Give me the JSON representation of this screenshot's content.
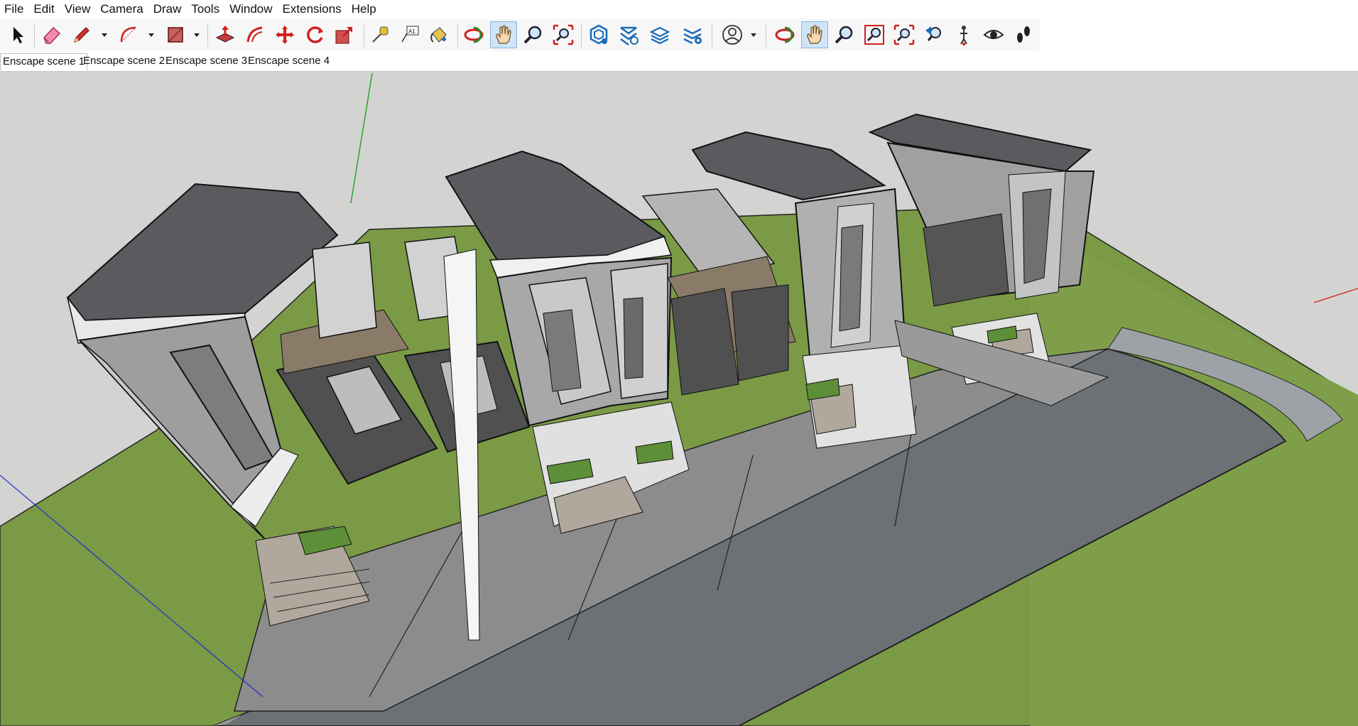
{
  "menu": [
    "File",
    "Edit",
    "View",
    "Camera",
    "Draw",
    "Tools",
    "Window",
    "Extensions",
    "Help"
  ],
  "toolbar": {
    "tools": [
      {
        "name": "select-icon"
      },
      {
        "name": "eraser-icon"
      },
      {
        "name": "pencil-line-icon"
      },
      {
        "name": "arc-icon"
      },
      {
        "name": "rectangle-icon"
      },
      {
        "name": "push-pull-icon"
      },
      {
        "name": "offset-icon"
      },
      {
        "name": "move-icon"
      },
      {
        "name": "rotate-icon"
      },
      {
        "name": "scale-icon"
      },
      {
        "name": "tape-measure-icon"
      },
      {
        "name": "text-label-icon"
      },
      {
        "name": "paint-bucket-icon"
      },
      {
        "name": "orbit-icon"
      },
      {
        "name": "pan-icon",
        "active": true
      },
      {
        "name": "zoom-icon"
      },
      {
        "name": "zoom-extents-icon"
      },
      {
        "name": "warehouse-icon"
      },
      {
        "name": "extension-warehouse-icon"
      },
      {
        "name": "layout-send-icon"
      },
      {
        "name": "extension-manager-icon"
      },
      {
        "name": "profile-icon"
      },
      {
        "name": "orbit-2-icon"
      },
      {
        "name": "pan-2-icon",
        "active": true
      },
      {
        "name": "zoom-2-icon"
      },
      {
        "name": "zoom-window-icon"
      },
      {
        "name": "zoom-extents-2-icon"
      },
      {
        "name": "previous-view-icon"
      },
      {
        "name": "position-camera-icon"
      },
      {
        "name": "look-around-icon"
      },
      {
        "name": "walk-icon"
      }
    ]
  },
  "scene_tabs": [
    "Enscape scene 1",
    "Enscape scene 2",
    "Enscape scene 3",
    "Enscape scene 4"
  ],
  "selected_scene": "Enscape scene 1",
  "colors": {
    "background": "#d3d3d1",
    "grass": "#7a9a46",
    "road": "#6c7175",
    "roof": "#5b5b5f",
    "wall_light": "#b9b9b9",
    "wall_dark": "#505050",
    "accent_active": "#cfe4f7",
    "axis_green": "#2aa52a",
    "axis_blue": "#2030c8",
    "axis_red": "#d02020"
  }
}
